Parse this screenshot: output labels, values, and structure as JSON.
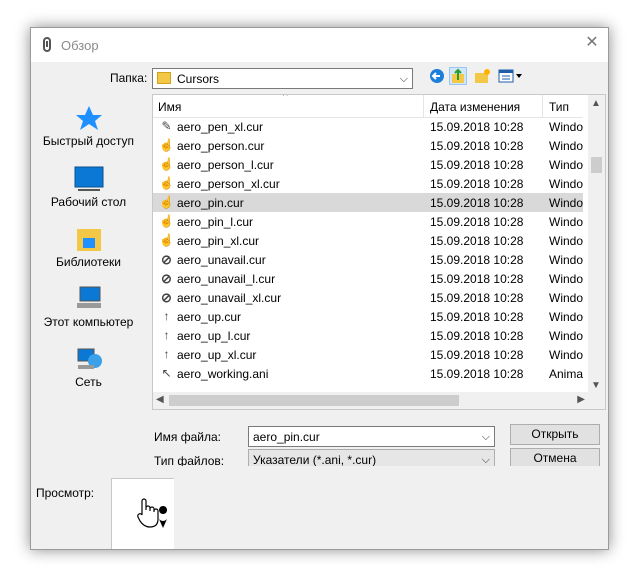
{
  "window": {
    "title": "Обзор",
    "close_glyph": "✕"
  },
  "folder": {
    "label": "Папка:",
    "value": "Cursors"
  },
  "places": [
    {
      "label": "Быстрый доступ",
      "icon": "star-icon"
    },
    {
      "label": "Рабочий стол",
      "icon": "desktop-icon"
    },
    {
      "label": "Библиотеки",
      "icon": "libraries-icon"
    },
    {
      "label": "Этот компьютер",
      "icon": "computer-icon"
    },
    {
      "label": "Сеть",
      "icon": "network-icon"
    }
  ],
  "columns": {
    "name": "Имя",
    "date": "Дата изменения",
    "type": "Тип"
  },
  "files": [
    {
      "name": "aero_pen_xl.cur",
      "date": "15.09.2018 10:28",
      "type": "Windo",
      "icon": "pen-cursor-icon"
    },
    {
      "name": "aero_person.cur",
      "date": "15.09.2018 10:28",
      "type": "Windo",
      "icon": "person-cursor-icon"
    },
    {
      "name": "aero_person_l.cur",
      "date": "15.09.2018 10:28",
      "type": "Windo",
      "icon": "person-cursor-icon"
    },
    {
      "name": "aero_person_xl.cur",
      "date": "15.09.2018 10:28",
      "type": "Windo",
      "icon": "person-cursor-icon"
    },
    {
      "name": "aero_pin.cur",
      "date": "15.09.2018 10:28",
      "type": "Windo",
      "icon": "pin-cursor-icon"
    },
    {
      "name": "aero_pin_l.cur",
      "date": "15.09.2018 10:28",
      "type": "Windo",
      "icon": "pin-cursor-icon"
    },
    {
      "name": "aero_pin_xl.cur",
      "date": "15.09.2018 10:28",
      "type": "Windo",
      "icon": "pin-cursor-icon"
    },
    {
      "name": "aero_unavail.cur",
      "date": "15.09.2018 10:28",
      "type": "Windo",
      "icon": "unavailable-icon"
    },
    {
      "name": "aero_unavail_l.cur",
      "date": "15.09.2018 10:28",
      "type": "Windo",
      "icon": "unavailable-icon"
    },
    {
      "name": "aero_unavail_xl.cur",
      "date": "15.09.2018 10:28",
      "type": "Windo",
      "icon": "unavailable-icon"
    },
    {
      "name": "aero_up.cur",
      "date": "15.09.2018 10:28",
      "type": "Windo",
      "icon": "up-arrow-icon"
    },
    {
      "name": "aero_up_l.cur",
      "date": "15.09.2018 10:28",
      "type": "Windo",
      "icon": "up-arrow-icon"
    },
    {
      "name": "aero_up_xl.cur",
      "date": "15.09.2018 10:28",
      "type": "Windo",
      "icon": "up-arrow-icon"
    },
    {
      "name": "aero_working.ani",
      "date": "15.09.2018 10:28",
      "type": "Anima",
      "icon": "working-cursor-icon"
    }
  ],
  "selected_file": "aero_pin.cur",
  "filename": {
    "label": "Имя файла:",
    "value": "aero_pin.cur"
  },
  "filetype": {
    "label": "Тип файлов:",
    "value": "Указатели (*.ani, *.cur)"
  },
  "buttons": {
    "open": "Открыть",
    "cancel": "Отмена"
  },
  "preview": {
    "label": "Просмотр:"
  },
  "colors": {
    "selection": "#d9d9d9",
    "folder": "#f3c846",
    "accent": "#1e90ff",
    "unavailable": "#dd1111"
  }
}
